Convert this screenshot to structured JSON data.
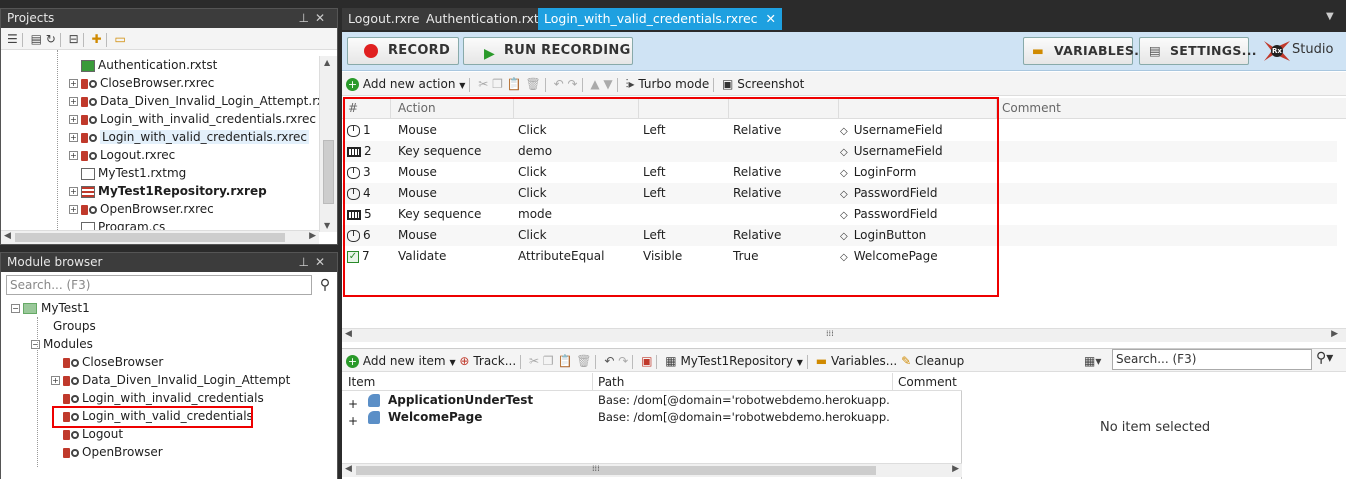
{
  "projects": {
    "title": "Projects",
    "pin": "📌",
    "close": "✕",
    "items": [
      {
        "label": "Authentication.rxtst",
        "icon": "folder-test-icon",
        "bold": false,
        "expand": ""
      },
      {
        "label": "CloseBrowser.rxrec",
        "icon": "recording-icon",
        "bold": false,
        "expand": "+"
      },
      {
        "label": "Data_Diven_Invalid_Login_Attempt.rxrec",
        "icon": "recording-icon",
        "bold": false,
        "expand": "+"
      },
      {
        "label": "Login_with_invalid_credentials.rxrec",
        "icon": "recording-icon",
        "bold": false,
        "expand": "+"
      },
      {
        "label": "Login_with_valid_credentials.rxrec",
        "icon": "recording-icon",
        "bold": false,
        "expand": "+",
        "selected": true
      },
      {
        "label": "Logout.rxrec",
        "icon": "recording-icon",
        "bold": false,
        "expand": "+"
      },
      {
        "label": "MyTest1.rxtmg",
        "icon": "module-group-icon",
        "bold": false,
        "expand": ""
      },
      {
        "label": "MyTest1Repository.rxrep",
        "icon": "repository-icon",
        "bold": true,
        "expand": "+"
      },
      {
        "label": "OpenBrowser.rxrec",
        "icon": "recording-icon",
        "bold": false,
        "expand": "+"
      },
      {
        "label": "Program.cs",
        "icon": "file-icon",
        "bold": false,
        "expand": ""
      }
    ]
  },
  "module_browser": {
    "title": "Module browser",
    "search_placeholder": "Search... (F3)",
    "root": "MyTest1",
    "groups": "Groups",
    "modules": "Modules",
    "items": [
      {
        "label": "CloseBrowser",
        "expand": ""
      },
      {
        "label": "Data_Diven_Invalid_Login_Attempt",
        "expand": "+"
      },
      {
        "label": "Login_with_invalid_credentials",
        "expand": ""
      },
      {
        "label": "Login_with_valid_credentials",
        "expand": "",
        "selected": true
      },
      {
        "label": "Logout",
        "expand": ""
      },
      {
        "label": "OpenBrowser",
        "expand": ""
      }
    ]
  },
  "tabs": [
    {
      "label": "Logout.rxrec",
      "active": false
    },
    {
      "label": "Authentication.rxtst",
      "active": false
    },
    {
      "label": "Login_with_valid_credentials.rxrec",
      "active": true
    }
  ],
  "tab_close": "✕",
  "toolbar": {
    "record": "RECORD",
    "run_recording": "RUN RECORDING",
    "variables": "VARIABLES...",
    "settings": "SETTINGS...",
    "studio": "Studio",
    "rx": "Rx"
  },
  "actions_toolbar": {
    "add_new_action": "Add new action",
    "turbo_mode": "Turbo mode",
    "screenshot": "Screenshot"
  },
  "grid": {
    "headers": {
      "num": "#",
      "action": "Action",
      "comment": "Comment"
    },
    "rows": [
      {
        "num": "1",
        "icon": "mouse-icon",
        "action": "Mouse",
        "p1": "Click",
        "p2": "Left",
        "p3": "Relative",
        "target": "UsernameField"
      },
      {
        "num": "2",
        "icon": "keyboard-icon",
        "action": "Key sequence",
        "p1": "demo",
        "p2": "",
        "p3": "",
        "target": "UsernameField"
      },
      {
        "num": "3",
        "icon": "mouse-icon",
        "action": "Mouse",
        "p1": "Click",
        "p2": "Left",
        "p3": "Relative",
        "target": "LoginForm"
      },
      {
        "num": "4",
        "icon": "mouse-icon",
        "action": "Mouse",
        "p1": "Click",
        "p2": "Left",
        "p3": "Relative",
        "target": "PasswordField"
      },
      {
        "num": "5",
        "icon": "keyboard-icon",
        "action": "Key sequence",
        "p1": "mode",
        "p2": "",
        "p3": "",
        "target": "PasswordField"
      },
      {
        "num": "6",
        "icon": "mouse-icon",
        "action": "Mouse",
        "p1": "Click",
        "p2": "Left",
        "p3": "Relative",
        "target": "LoginButton"
      },
      {
        "num": "7",
        "icon": "validate-icon",
        "action": "Validate",
        "p1": "AttributeEqual",
        "p2": "Visible",
        "p3": "True",
        "target": "WelcomePage"
      }
    ]
  },
  "repo_toolbar": {
    "add_new_item": "Add new item",
    "track": "Track...",
    "repository": "MyTest1Repository",
    "variables": "Variables...",
    "cleanup": "Cleanup",
    "search_placeholder": "Search... (F3)"
  },
  "repo_grid": {
    "headers": {
      "item": "Item",
      "path": "Path",
      "comment": "Comment"
    },
    "rows": [
      {
        "item": "ApplicationUnderTest",
        "path": "Base: /dom[@domain='robotwebdemo.herokuapp.co..."
      },
      {
        "item": "WelcomePage",
        "path": "Base: /dom[@domain='robotwebdemo.herokuapp.co..."
      }
    ]
  },
  "no_item_selected": "No item selected",
  "colors": {
    "accent": "#1ea0e0",
    "highlight": "#e00000",
    "record": "#e02020"
  }
}
